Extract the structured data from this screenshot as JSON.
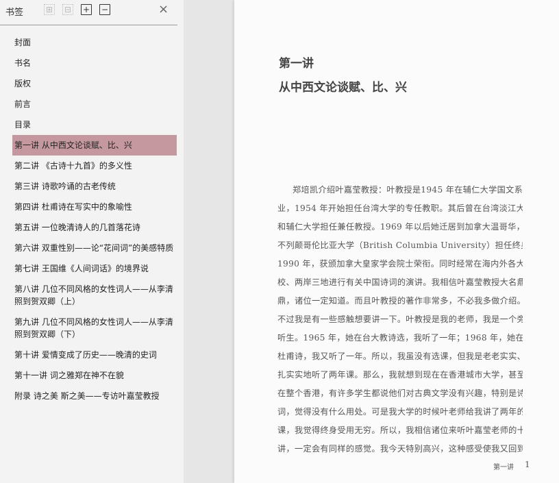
{
  "sidebar": {
    "title": "书签",
    "buttons": {
      "expand": "⊞",
      "collapse": "⊟",
      "add": "+",
      "remove": "−",
      "close": "×"
    },
    "items": [
      {
        "label": "封面"
      },
      {
        "label": "书名"
      },
      {
        "label": "版权"
      },
      {
        "label": "前言"
      },
      {
        "label": "目录"
      },
      {
        "label": "第一讲  从中西文论谈赋、比、兴",
        "selected": true
      },
      {
        "label": "第二讲  《古诗十九首》的多义性"
      },
      {
        "label": "第三讲  诗歌吟诵的古老传统"
      },
      {
        "label": "第四讲  杜甫诗在写实中的象喻性"
      },
      {
        "label": "第五讲  一位晚清诗人的几首落花诗"
      },
      {
        "label": "第六讲  双重性别——论“花间词”的美感特质"
      },
      {
        "label": "第七讲  王国维《人间词话》的境界说"
      },
      {
        "label": "第八讲  几位不同风格的女性词人——从李清照到贺双卿（上）"
      },
      {
        "label": "第九讲  几位不同风格的女性词人——从李清照到贺双卿（下）"
      },
      {
        "label": "第十讲  爱情变成了历史——晚清的史词"
      },
      {
        "label": "第十一讲  词之雅郑在神不在貌"
      },
      {
        "label": "附录  诗之美  斯之美——专访叶嘉莹教授"
      }
    ],
    "selected_color": "#c4989e"
  },
  "page": {
    "chapter": "第一讲",
    "title": "从中西文论谈赋、比、兴",
    "lines": [
      "郑培凯介绍叶嘉莹教授：叶教授是1945 年在辅仁大学国文系毕",
      "业，1954 年开始担任台湾大学的专任教职。其后曾在台湾淡江大学",
      "和辅仁大学担任兼任教授。1969 年以后她迁居到加拿大温哥华，在",
      "不列颠哥伦比亚大学（British Columbia University）担任终身教授。",
      "1990 年，获颁加拿大皇家学会院士荣衔。同时经常在海内外各大名",
      "校、两岸三地进行有关中国诗词的演讲。我相信叶嘉莹教授大名鼎",
      "鼎，诸位一定知道。而且叶教授的著作非常多，不必我多做介绍。",
      "不过我是有一些感触想要讲一下。叶教授是我的老师，我是一个旁",
      "听生。1965 年，她在台大教诗选，我听了一年；1968 年，她在台大教",
      "杜甫诗，我又听了一年。所以，我虽没有选课，但我是老老实实、扎",
      "扎实实地听了两年课。那么，我就想到现在在香港城市大学，甚至",
      "在整个香港，有许多学生都说他们对古典文学没有兴趣，特别是诗",
      "词，觉得没有什么用处。可是我大学的时候叶老师给我讲了两年的",
      "课，我觉得终身受用无穷。所以，我相信诸位来听叶嘉莹老师的十",
      "讲，一定会有同样的感觉。我今天特别高兴，这种感受使我又回到"
    ],
    "footer": "第一讲",
    "page_number": "1"
  }
}
